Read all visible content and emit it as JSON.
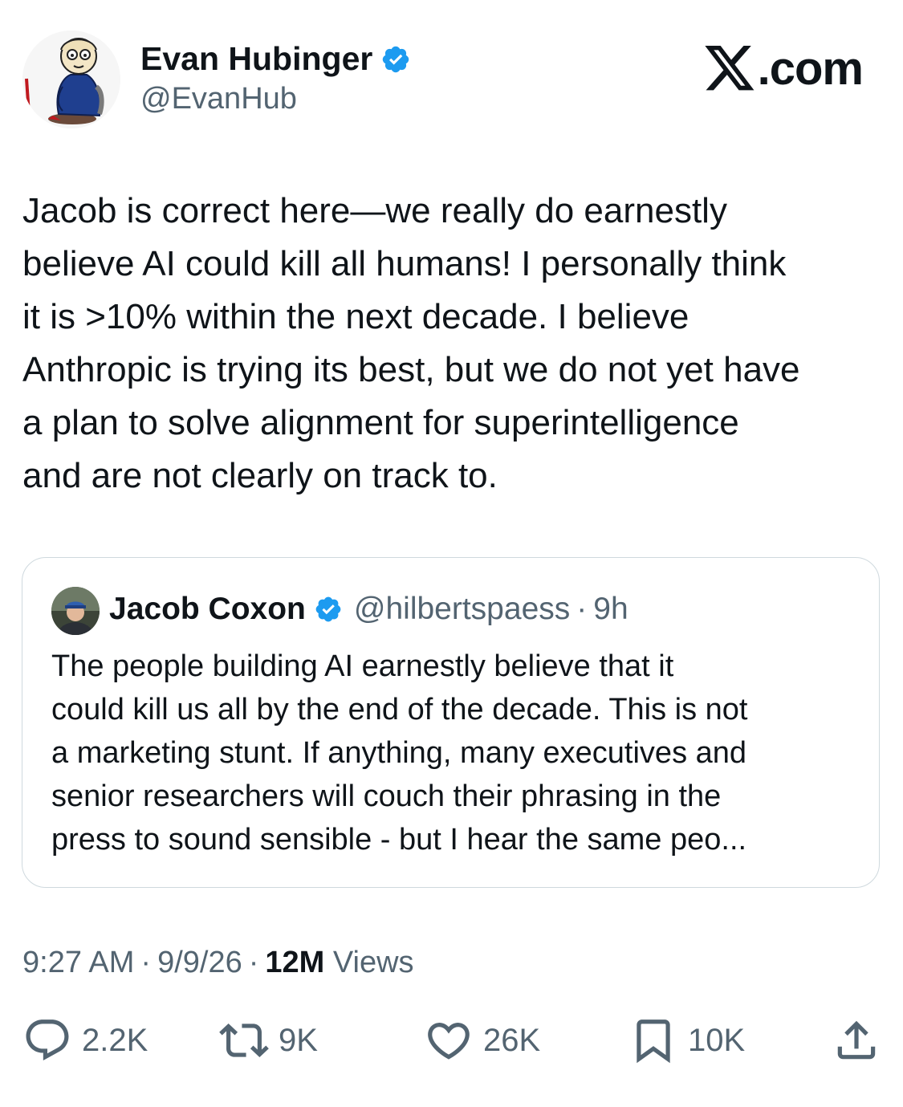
{
  "author": {
    "name": "Evan Hubinger",
    "handle": "@EvanHub"
  },
  "brand": {
    "label": ".com"
  },
  "tweet": {
    "lines": [
      "Jacob is correct here—we really do earnestly",
      "believe AI could kill all humans! I personally think",
      "it is >10% within the next decade. I believe",
      "Anthropic is trying its best, but we do not yet have",
      "a plan to solve alignment for superintelligence",
      "and are not clearly on track to."
    ]
  },
  "quote": {
    "name": "Jacob Coxon",
    "handle": "@hilbertspaess",
    "separator": "·",
    "age": "9h",
    "lines": [
      "The people building AI earnestly believe that it",
      "could kill us all by the end of the decade. This is not",
      "a marketing stunt. If anything, many executives and",
      "senior researchers will couch their phrasing in the",
      "press to sound sensible - but I hear the same peo..."
    ]
  },
  "meta": {
    "time": "9:27 AM",
    "separator": "·",
    "date": "9/9/26",
    "views_count": "12M",
    "views_label": "Views"
  },
  "actions": {
    "replies": "2.2K",
    "reposts": "9K",
    "likes": "26K",
    "bookmarks": "10K"
  },
  "colors": {
    "text": "#0f1419",
    "secondary": "#536471",
    "verified": "#1d9bf0",
    "border": "#cfd9de"
  },
  "icons": {
    "verified": "verified-badge-icon",
    "logo": "x-logo-icon",
    "reply": "reply-icon",
    "repost": "repost-icon",
    "like": "heart-icon",
    "bookmark": "bookmark-icon",
    "share": "share-icon"
  }
}
